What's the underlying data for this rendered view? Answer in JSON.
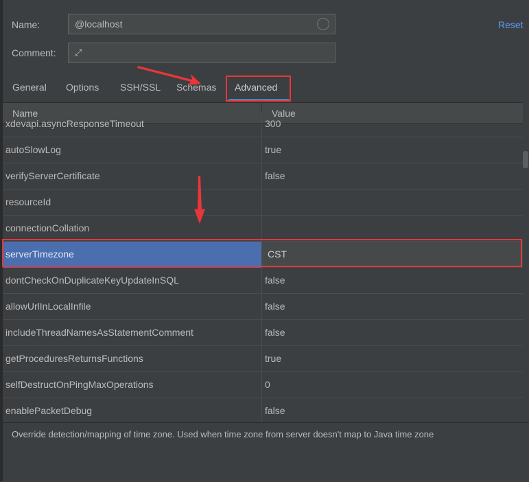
{
  "form": {
    "name_label": "Name:",
    "name_value": "@localhost",
    "comment_label": "Comment:",
    "comment_value": "",
    "reset_label": "Reset"
  },
  "tabs": [
    {
      "label": "General"
    },
    {
      "label": "Options"
    },
    {
      "label": "SSH/SSL"
    },
    {
      "label": "Schemas"
    },
    {
      "label": "Advanced",
      "active": true
    }
  ],
  "table": {
    "headers": [
      "Name",
      "Value"
    ],
    "rows": [
      {
        "name": "xdevapi.asyncResponseTimeout",
        "value": "300"
      },
      {
        "name": "autoSlowLog",
        "value": "true"
      },
      {
        "name": "verifyServerCertificate",
        "value": "false"
      },
      {
        "name": "resourceId",
        "value": ""
      },
      {
        "name": "connectionCollation",
        "value": ""
      },
      {
        "name": "serverTimezone",
        "value": "CST",
        "selected": true
      },
      {
        "name": "dontCheckOnDuplicateKeyUpdateInSQL",
        "value": "false"
      },
      {
        "name": "allowUrlInLocalInfile",
        "value": "false"
      },
      {
        "name": "includeThreadNamesAsStatementComment",
        "value": "false"
      },
      {
        "name": "getProceduresReturnsFunctions",
        "value": "true"
      },
      {
        "name": "selfDestructOnPingMaxOperations",
        "value": "0"
      },
      {
        "name": "enablePacketDebug",
        "value": "false"
      }
    ]
  },
  "description": "Override detection/mapping of time zone. Used when time zone from server doesn't map to Java time zone",
  "colors": {
    "background": "#3c3f41",
    "selection": "#4b6eaf",
    "accent": "#4a88c7",
    "annotation": "#e8363a",
    "link": "#589df6"
  }
}
